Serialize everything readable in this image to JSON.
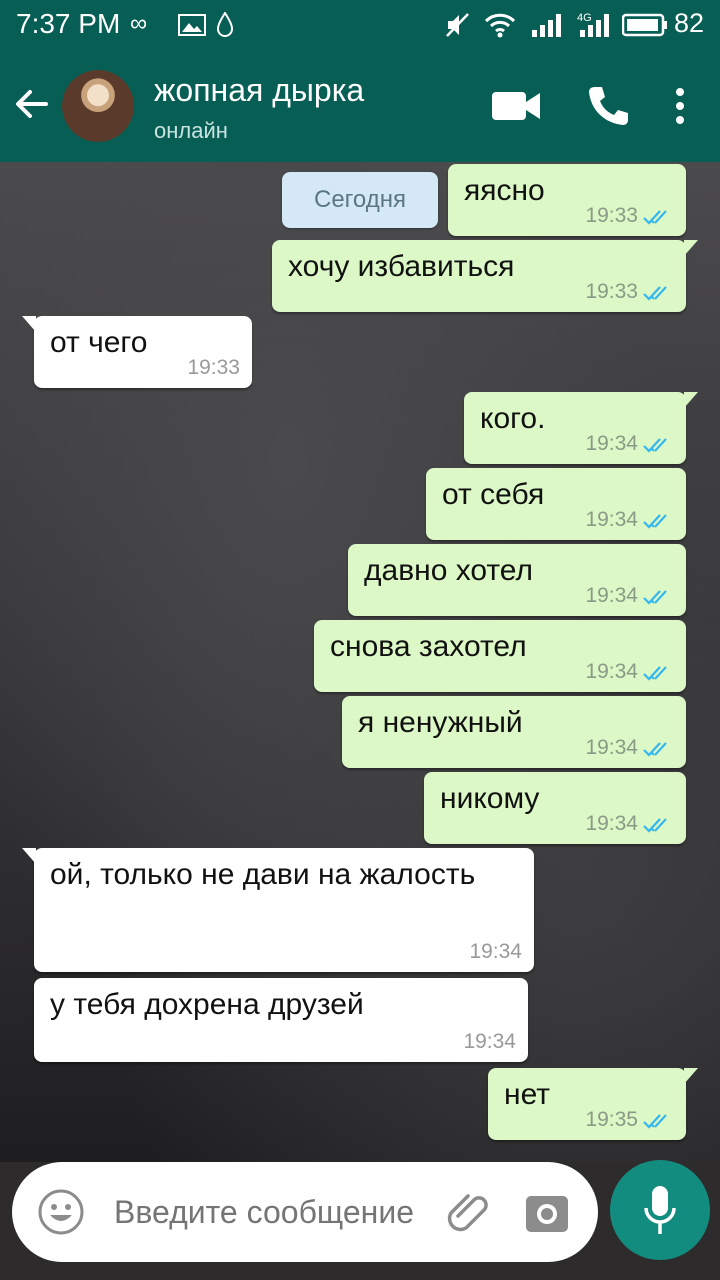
{
  "status_bar": {
    "time": "7:37 PM",
    "network_label": "4G",
    "battery": "82"
  },
  "header": {
    "contact_name": "жопная дырка",
    "contact_status": "онлайн"
  },
  "date_chip": "Сегодня",
  "messages": [
    {
      "dir": "out",
      "text": "яясно",
      "time": "19:33",
      "read": true
    },
    {
      "dir": "out",
      "text": "хочу избавиться",
      "time": "19:33",
      "read": true
    },
    {
      "dir": "in",
      "text": "от чего",
      "time": "19:33"
    },
    {
      "dir": "out",
      "text": "кого.",
      "time": "19:34",
      "read": true
    },
    {
      "dir": "out",
      "text": "от себя",
      "time": "19:34",
      "read": true
    },
    {
      "dir": "out",
      "text": "давно хотел",
      "time": "19:34",
      "read": true
    },
    {
      "dir": "out",
      "text": "снова захотел",
      "time": "19:34",
      "read": true
    },
    {
      "dir": "out",
      "text": "я ненужный",
      "time": "19:34",
      "read": true
    },
    {
      "dir": "out",
      "text": "никому",
      "time": "19:34",
      "read": true
    },
    {
      "dir": "in",
      "text": "ой, только не дави на жалость",
      "time": "19:34"
    },
    {
      "dir": "in",
      "text": "у тебя дохрена друзей",
      "time": "19:34"
    },
    {
      "dir": "out",
      "text": "нет",
      "time": "19:35",
      "read": true
    }
  ],
  "composer": {
    "placeholder": "Введите сообщение"
  },
  "colors": {
    "header": "#075e54",
    "outgoing_bubble": "#dcf8c6",
    "incoming_bubble": "#ffffff",
    "read_ticks": "#34b7f1",
    "fab": "#128c7e"
  }
}
